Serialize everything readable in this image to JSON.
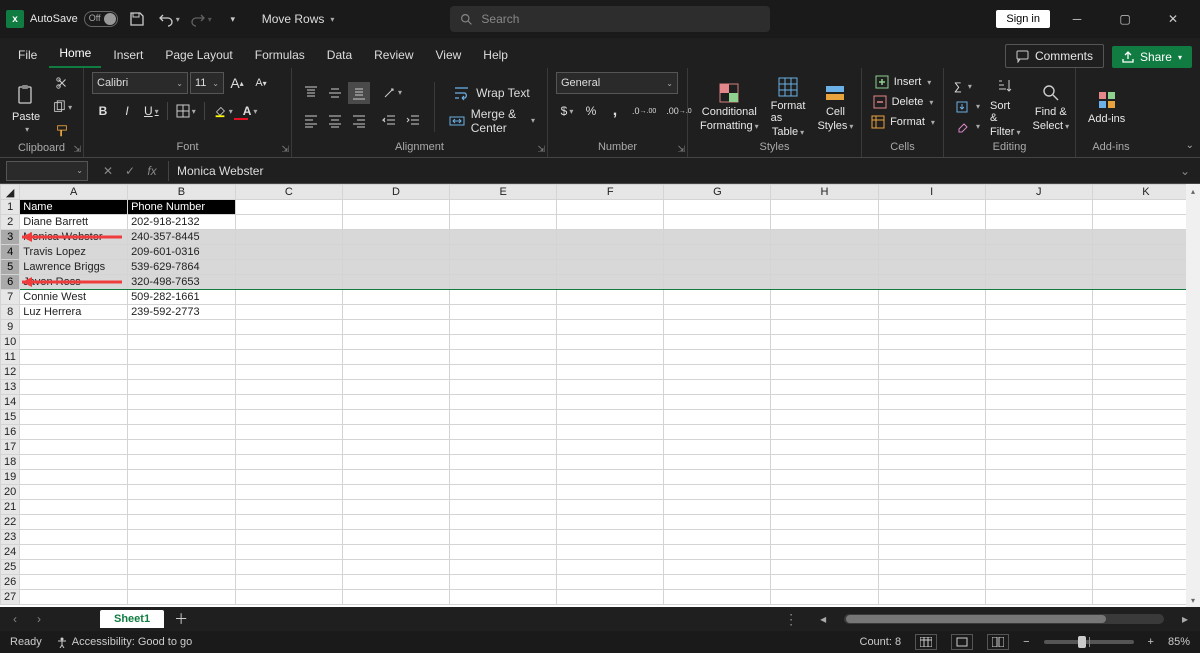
{
  "titlebar": {
    "autosave_label": "AutoSave",
    "autosave_state": "Off",
    "doc_name": "Move Rows",
    "search_placeholder": "Search",
    "signin": "Sign in"
  },
  "tabs": {
    "items": [
      "File",
      "Home",
      "Insert",
      "Page Layout",
      "Formulas",
      "Data",
      "Review",
      "View",
      "Help"
    ],
    "active_index": 1,
    "comments": "Comments",
    "share": "Share"
  },
  "ribbon": {
    "clipboard": {
      "label": "Clipboard",
      "paste": "Paste"
    },
    "font": {
      "label": "Font",
      "name": "Calibri",
      "size": "11"
    },
    "alignment": {
      "label": "Alignment",
      "wrap": "Wrap Text",
      "merge": "Merge & Center"
    },
    "number": {
      "label": "Number",
      "format": "General"
    },
    "styles": {
      "label": "Styles",
      "conditional1": "Conditional",
      "conditional2": "Formatting",
      "table1": "Format as",
      "table2": "Table",
      "cell1": "Cell",
      "cell2": "Styles"
    },
    "cells": {
      "label": "Cells",
      "insert": "Insert",
      "delete": "Delete",
      "format": "Format"
    },
    "editing": {
      "label": "Editing",
      "sort1": "Sort &",
      "sort2": "Filter",
      "find1": "Find &",
      "find2": "Select"
    },
    "addins": {
      "label": "Add-ins",
      "btn": "Add-ins"
    }
  },
  "formula_bar": {
    "namebox": "",
    "value": "Monica Webster"
  },
  "grid": {
    "columns": [
      "A",
      "B",
      "C",
      "D",
      "E",
      "F",
      "G",
      "H",
      "I",
      "J",
      "K"
    ],
    "header_row": [
      "Name",
      "Phone Number"
    ],
    "rows": [
      [
        "Diane Barrett",
        "202-918-2132"
      ],
      [
        "Monica Webster",
        "240-357-8445"
      ],
      [
        "Travis Lopez",
        "209-601-0316"
      ],
      [
        "Lawrence Briggs",
        "539-629-7864"
      ],
      [
        "Javon Ross",
        "320-498-7653"
      ],
      [
        "Connie West",
        "509-282-1661"
      ],
      [
        "Luz Herrera",
        "239-592-2773"
      ]
    ],
    "selection_start_row": 3,
    "selection_end_row": 6,
    "blank_rows": 19
  },
  "sheetbar": {
    "tab": "Sheet1"
  },
  "status": {
    "ready": "Ready",
    "accessibility": "Accessibility: Good to go",
    "count_label": "Count: 8",
    "zoom": "85%"
  }
}
